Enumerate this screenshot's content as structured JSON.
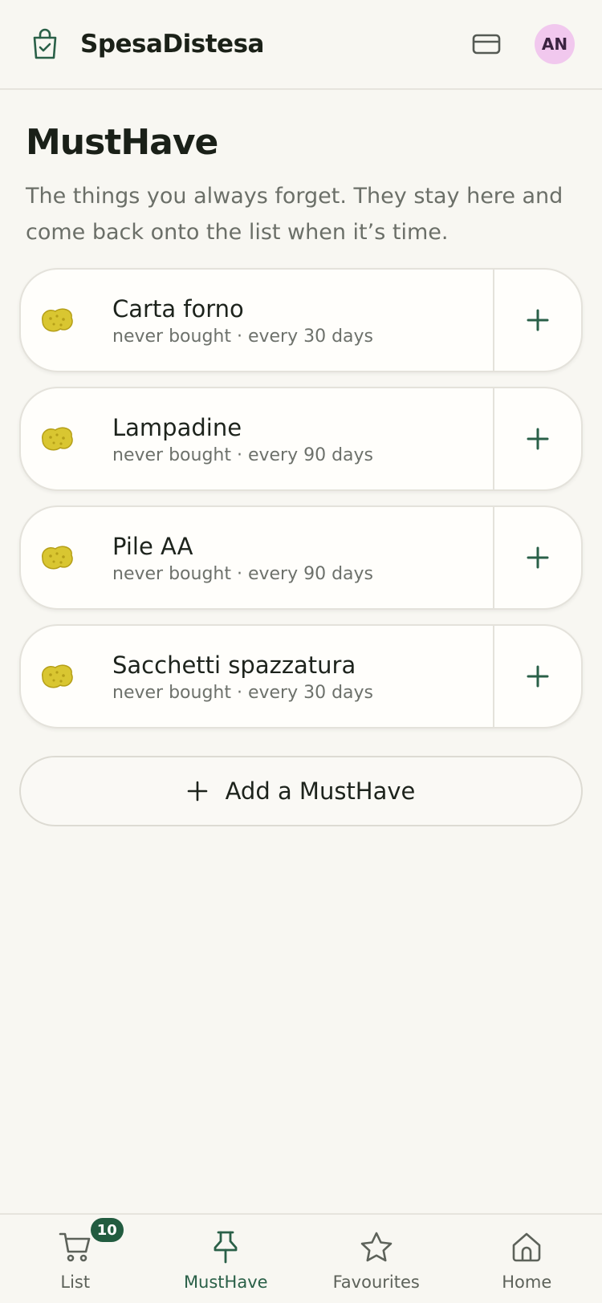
{
  "header": {
    "brand": "SpesaDistesa",
    "avatar_initials": "AN",
    "icons": {
      "logo": "shopping-bag-check-icon",
      "card": "credit-card-icon"
    }
  },
  "main": {
    "title": "MustHave",
    "description": "The things you always forget. They stay here and come back onto the list when it’s time.",
    "items": [
      {
        "name": "Carta forno",
        "meta": "never bought · every 30 days",
        "icon": "sponge-emoji"
      },
      {
        "name": "Lampadine",
        "meta": "never bought · every 90 days",
        "icon": "sponge-emoji"
      },
      {
        "name": "Pile AA",
        "meta": "never bought · every 90 days",
        "icon": "sponge-emoji"
      },
      {
        "name": "Sacchetti spazzatura",
        "meta": "never bought · every 30 days",
        "icon": "sponge-emoji"
      }
    ],
    "add_label": "Add a MustHave"
  },
  "nav": {
    "items": [
      {
        "label": "List",
        "icon": "cart-icon",
        "badge": "10"
      },
      {
        "label": "MustHave",
        "icon": "pin-icon",
        "active": true
      },
      {
        "label": "Favourites",
        "icon": "star-icon"
      },
      {
        "label": "Home",
        "icon": "home-icon"
      }
    ]
  },
  "colors": {
    "accent": "#2a6048",
    "background": "#f8f7f2",
    "avatar_bg": "#f1c8ee",
    "badge_bg": "#225c40"
  }
}
